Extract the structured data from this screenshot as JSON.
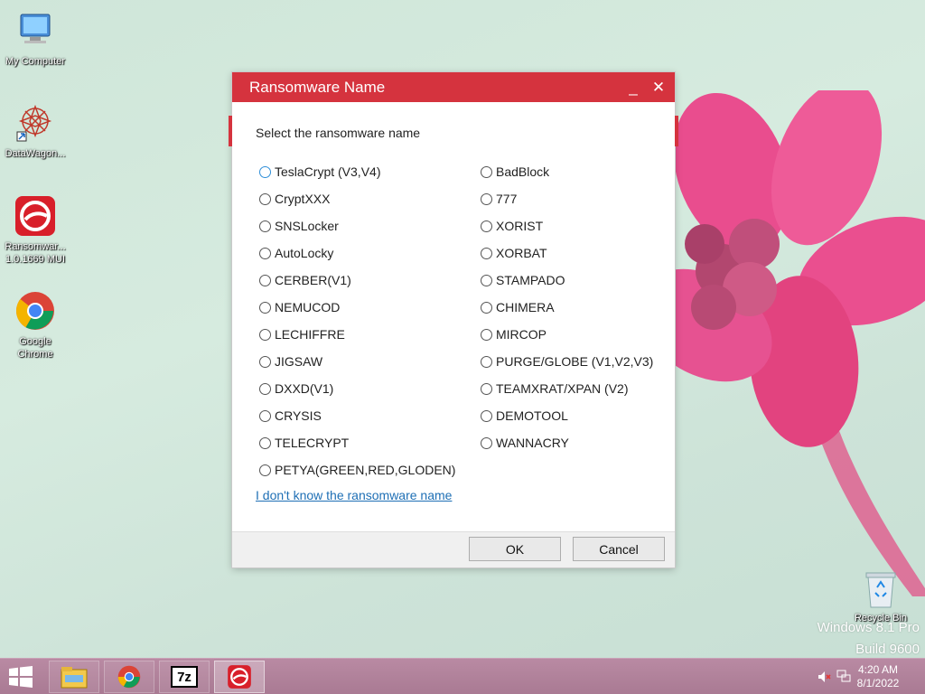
{
  "desktop": {
    "icons": [
      {
        "label": "My Computer"
      },
      {
        "label": "DataWagon..."
      },
      {
        "label": "Ransomwar...",
        "label2": "1.0.1669 MUI"
      },
      {
        "label": "Google",
        "label2": "Chrome"
      },
      {
        "label": "Recycle Bin"
      }
    ],
    "watermark_line1": "Windows 8.1 Pro",
    "watermark_line2": "Build 9600"
  },
  "dialog": {
    "title": "Ransomware Name",
    "minimize": "_",
    "close": "✕",
    "subtitle": "Select the ransomware name",
    "options_left": [
      "TeslaCrypt (V3,V4)",
      "CryptXXX",
      "SNSLocker",
      "AutoLocky",
      "CERBER(V1)",
      "NEMUCOD",
      "LECHIFFRE",
      "JIGSAW",
      "DXXD(V1)",
      "CRYSIS",
      "TELECRYPT",
      "PETYA(GREEN,RED,GLODEN)"
    ],
    "options_right": [
      "BadBlock",
      "777",
      "XORIST",
      "XORBAT",
      "STAMPADO",
      "CHIMERA",
      "MIRCOP",
      "PURGE/GLOBE (V1,V2,V3)",
      "TEAMXRAT/XPAN (V2)",
      "DEMOTOOL",
      "WANNACRY"
    ],
    "link": "I don't know the ransomware name",
    "ok": "OK",
    "cancel": "Cancel"
  },
  "taskbar": {
    "time": "4:20 AM",
    "date": "8/1/2022",
    "seven_zip": "7z"
  },
  "colors": {
    "accent": "#d5333e",
    "link": "#1e6fb5"
  }
}
